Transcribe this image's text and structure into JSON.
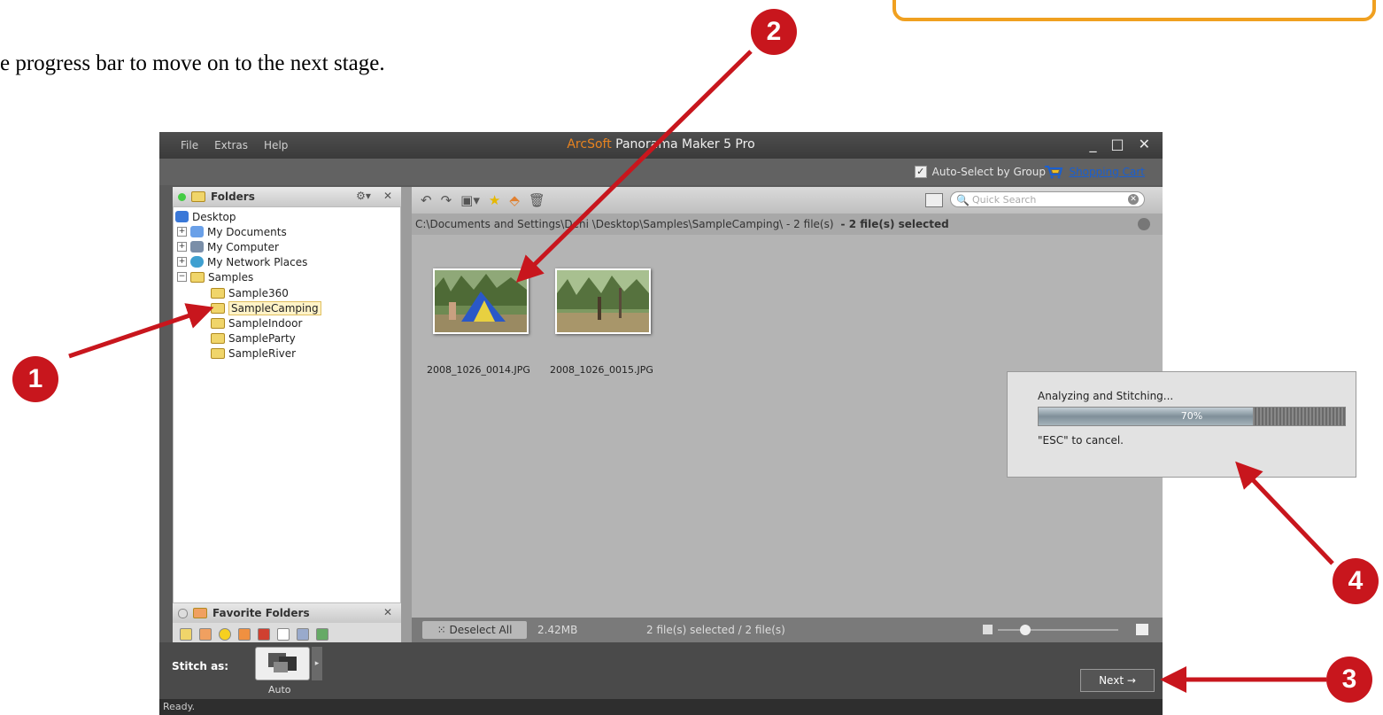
{
  "doc": {
    "instruction_text": "e progress bar to move on to the next stage."
  },
  "window": {
    "menu": [
      "File",
      "Extras",
      "Help"
    ],
    "title_brand": "ArcSoft",
    "title_rest": " Panorama Maker 5 Pro",
    "controls": [
      "_",
      "□",
      "✕"
    ]
  },
  "topbar": {
    "auto_select_label": "Auto-Select by Group",
    "auto_select_checked": true,
    "shopping_cart_label": "Shopping Cart"
  },
  "folders_panel": {
    "title": "Folders",
    "tree": [
      {
        "label": "Desktop",
        "level": 0
      },
      {
        "label": "My Documents",
        "level": 1,
        "expander": "+"
      },
      {
        "label": "My Computer",
        "level": 1,
        "expander": "+"
      },
      {
        "label": "My Network Places",
        "level": 1,
        "expander": "+"
      },
      {
        "label": "Samples",
        "level": 1,
        "expander": "−"
      },
      {
        "label": "Sample360",
        "level": 2
      },
      {
        "label": "SampleCamping",
        "level": 2,
        "selected": true
      },
      {
        "label": "SampleIndoor",
        "level": 2
      },
      {
        "label": "SampleParty",
        "level": 2
      },
      {
        "label": "SampleRiver",
        "level": 2
      }
    ],
    "favorites_title": "Favorite Folders"
  },
  "browser": {
    "search_placeholder": "Quick Search",
    "path": "C:\\Documents and Settings\\Deni  \\Desktop\\Samples\\SampleCamping\\ - 2 file(s)",
    "selection_summary": "- 2 file(s) selected",
    "files": [
      {
        "name": "2008_1026_0014.JPG"
      },
      {
        "name": "2008_1026_0015.JPG"
      }
    ],
    "deselect_label": "Deselect All",
    "total_size": "2.42MB",
    "selected_count": "2 file(s) selected / 2 file(s)",
    "thumb_zoom_level": 0.2
  },
  "stitch": {
    "label": "Stitch as:",
    "mode": "Auto",
    "next_label": "Next  →"
  },
  "status": {
    "text": "Ready."
  },
  "progress_dialog": {
    "title": "Analyzing and Stitching...",
    "percent": 70,
    "percent_label": "70%",
    "cancel_hint": "\"ESC\" to cancel."
  },
  "markers": [
    "1",
    "2",
    "3",
    "4"
  ],
  "colors": {
    "marker_red": "#c8161d",
    "orange_border": "#f0a020",
    "brand_orange": "#e8831f",
    "link_blue": "#1a5fd0"
  }
}
